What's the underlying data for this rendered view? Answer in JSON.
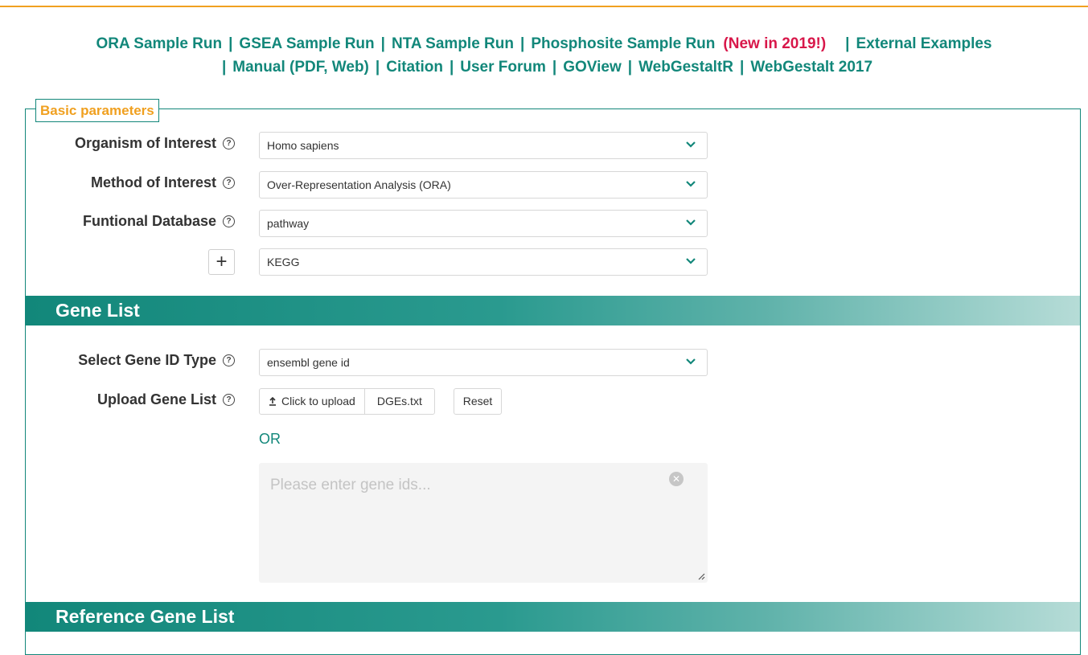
{
  "nav": {
    "row1": [
      {
        "label": "ORA Sample Run"
      },
      {
        "label": "GSEA Sample Run"
      },
      {
        "label": "NTA Sample Run"
      },
      {
        "label": "Phosphosite Sample Run"
      }
    ],
    "new_badge": "(New in 2019!)",
    "external_examples": "External Examples",
    "row2": [
      {
        "label": "Manual (PDF, Web)"
      },
      {
        "label": "Citation"
      },
      {
        "label": "User Forum"
      },
      {
        "label": "GOView"
      },
      {
        "label": "WebGestaltR"
      },
      {
        "label": "WebGestalt 2017"
      }
    ],
    "separator": "|"
  },
  "basic": {
    "legend": "Basic parameters",
    "organism_label": "Organism of Interest",
    "organism_value": "Homo sapiens",
    "method_label": "Method of Interest",
    "method_value": "Over-Representation Analysis (ORA)",
    "database_label": "Funtional Database",
    "database_value": "pathway",
    "database_sub_value": "KEGG",
    "add_symbol": "+"
  },
  "gene_list": {
    "title": "Gene List",
    "id_type_label": "Select Gene ID Type",
    "id_type_value": "ensembl gene id",
    "upload_label": "Upload Gene List",
    "upload_button": "Click to upload",
    "file_name": "DGEs.txt",
    "reset_button": "Reset",
    "or_text": "OR",
    "textarea_placeholder": "Please enter gene ids..."
  },
  "reference": {
    "title": "Reference Gene List"
  },
  "colors": {
    "accent": "#12877a",
    "highlight": "#f0a020",
    "new_badge": "#d8174a"
  }
}
